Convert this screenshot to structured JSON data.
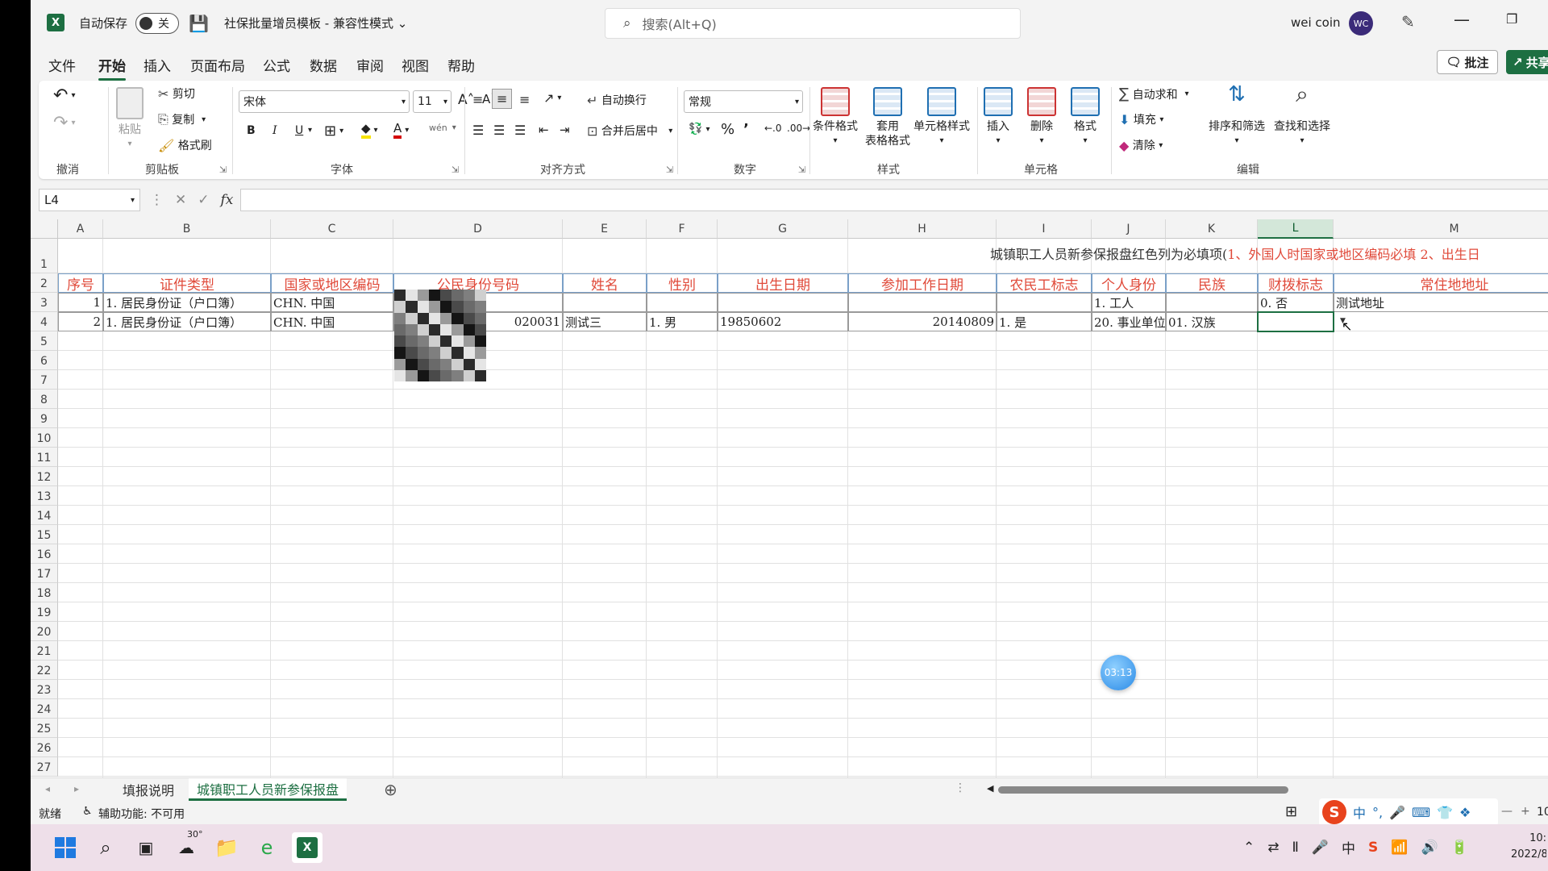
{
  "titlebar": {
    "autosave_label": "自动保存",
    "autosave_state": "关",
    "doc_title": "社保批量增员模板 - 兼容性模式 ⌄",
    "search_placeholder": "搜索(Alt+Q)",
    "user_name": "wei coin",
    "avatar_initials": "WC"
  },
  "menu": {
    "tabs": [
      "文件",
      "开始",
      "插入",
      "页面布局",
      "公式",
      "数据",
      "审阅",
      "视图",
      "帮助"
    ],
    "active_tab": "开始",
    "comment_label": "批注",
    "share_label": "共享"
  },
  "ribbon": {
    "groups": {
      "undo": "撤消",
      "clipboard": "剪贴板",
      "font": "字体",
      "align": "对齐方式",
      "number": "数字",
      "styles": "样式",
      "cells": "单元格",
      "editing": "编辑"
    },
    "clipboard": {
      "paste": "粘贴",
      "cut": "剪切",
      "copy": "复制",
      "format_painter": "格式刷"
    },
    "font": {
      "name": "宋体",
      "size": "11",
      "bold": "B",
      "italic": "I",
      "underline": "U"
    },
    "align": {
      "wrap": "自动换行",
      "merge": "合并后居中"
    },
    "number": {
      "format": "常规"
    },
    "styles": {
      "conditional": "条件格式",
      "table_format_1": "套用",
      "table_format_2": "表格格式",
      "cell_styles": "单元格样式"
    },
    "cells": {
      "insert": "插入",
      "delete": "删除",
      "format": "格式"
    },
    "editing": {
      "autosum": "自动求和",
      "fill": "填充",
      "clear": "清除",
      "sort_filter": "排序和筛选",
      "find_select": "查找和选择"
    }
  },
  "formula_bar": {
    "name_box": "L4",
    "fx": "fx",
    "content": ""
  },
  "sheet": {
    "columns": [
      "A",
      "B",
      "C",
      "D",
      "E",
      "F",
      "G",
      "H",
      "I",
      "J",
      "K",
      "L",
      "M"
    ],
    "selected_column": "L",
    "row_numbers": [
      "1",
      "2",
      "3",
      "4",
      "5",
      "6",
      "7",
      "8",
      "9",
      "10",
      "11",
      "12",
      "13",
      "14",
      "15",
      "16",
      "17",
      "18",
      "19",
      "20",
      "21",
      "22",
      "23",
      "24",
      "25",
      "26",
      "27"
    ],
    "banner_black": "城镇职工人员新参保报盘红色列为必填项(",
    "banner_red": "1、外国人时国家或地区编码必填 2、出生日",
    "headers": [
      "序号",
      "证件类型",
      "国家或地区编码",
      "公民身份号码",
      "姓名",
      "性别",
      "出生日期",
      "参加工作日期",
      "农民工标志",
      "个人身份",
      "民族",
      "财拨标志",
      "常住地地址"
    ],
    "row3": {
      "A": "1",
      "B": "1. 居民身份证（户口簿）",
      "C": "CHN. 中国",
      "J": "1. 工人",
      "L": "0. 否",
      "M": "测试地址"
    },
    "row4": {
      "A": "2",
      "B": "1. 居民身份证（户口簿）",
      "C": "CHN. 中国",
      "D": "020031",
      "E": "测试三",
      "F": "1. 男",
      "G": "19850602",
      "H": "20140809",
      "I": "1. 是",
      "J": "20. 事业单位",
      "K": "01. 汉族"
    }
  },
  "timer_badge": "03:13",
  "sheet_tabs": [
    "填报说明",
    "城镇职工人员新参保报盘"
  ],
  "active_sheet": "城镇职工人员新参保报盘",
  "status": {
    "ready": "就绪",
    "accessibility": "辅助功能: 不可用",
    "zoom_partial": "10"
  },
  "taskbar": {
    "weather_temp": "30°",
    "clock_time": "10:",
    "clock_date": "2022/8"
  },
  "colors": {
    "excel_green": "#1d6f42",
    "header_red": "#e04a3a",
    "avatar": "#3b2b79"
  }
}
